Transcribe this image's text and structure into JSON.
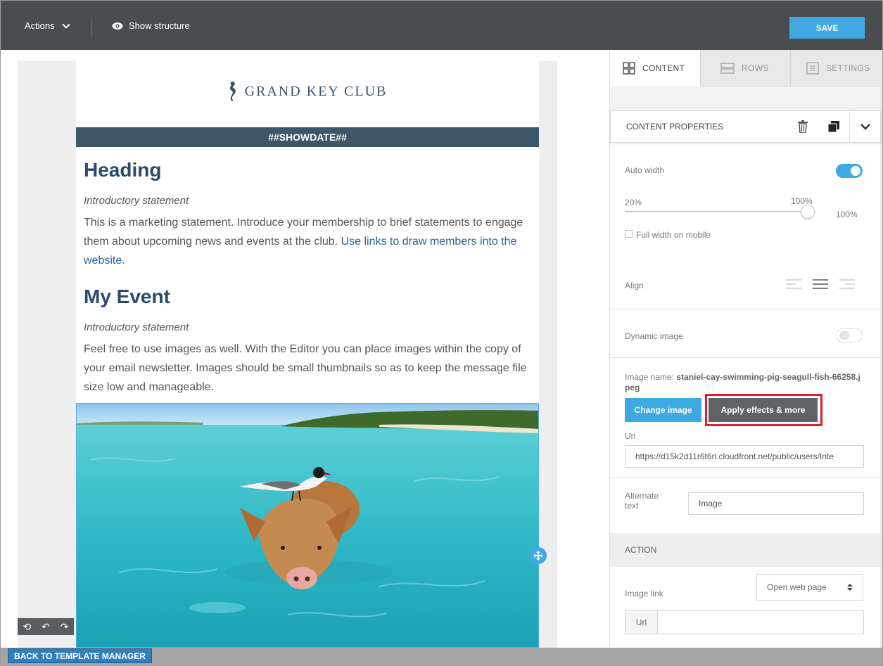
{
  "toolbar": {
    "actions_label": "Actions",
    "show_structure_label": "Show structure",
    "save_label": "SAVE"
  },
  "email": {
    "logo_text": "GRAND KEY CLUB",
    "date_bar": "##SHOWDATE##",
    "section1": {
      "heading": "Heading",
      "intro": "Introductory statement",
      "body": "This is a marketing statement. Introduce your membership to brief statements to engage them about upcoming news and events at the club.",
      "link": "Use links to draw members into the website."
    },
    "section2": {
      "heading": "My Event",
      "intro": "Introductory statement",
      "body": "Feel free to use images as well. With the Editor you can place images within the copy of your email newsletter. Images should be small thumbnails so as to keep the message file size low and manageable."
    }
  },
  "panel": {
    "tabs": [
      {
        "label": "CONTENT",
        "icon": "grid-icon",
        "active": true
      },
      {
        "label": "ROWS",
        "icon": "rows-icon",
        "active": false
      },
      {
        "label": "SETTINGS",
        "icon": "settings-icon",
        "active": false
      }
    ],
    "content_properties_label": "CONTENT PROPERTIES",
    "auto_width_label": "Auto width",
    "auto_width_on": true,
    "slider_min_label": "20%",
    "slider_max_label": "100%",
    "slider_value": "100%",
    "full_width_mobile_label": "Full width on mobile",
    "align_label": "Align",
    "dynamic_image_label": "Dynamic image",
    "dynamic_image_on": false,
    "image_name_label": "Image name:",
    "image_name_value": "staniel-cay-swimming-pig-seagull-fish-66258.jpeg",
    "change_image_label": "Change image",
    "apply_effects_label": "Apply effects & more",
    "url_label": "Url",
    "url_value": "https://d15k2d11r6t6rl.cloudfront.net/public/users/Inte",
    "alt_text_label": "Alternate text",
    "alt_text_value": "Image",
    "action_section_label": "ACTION",
    "image_link_label": "Image link",
    "image_link_select": "Open web page",
    "link_url_label": "Url",
    "link_url_value": ""
  },
  "footer": {
    "back_label": "BACK TO TEMPLATE MANAGER"
  },
  "colors": {
    "topbar": "#4a4d50",
    "accent": "#3fa9e4",
    "heading": "#2c4a6a",
    "date_bar": "#3d566a",
    "highlight": "#e01e2e"
  }
}
